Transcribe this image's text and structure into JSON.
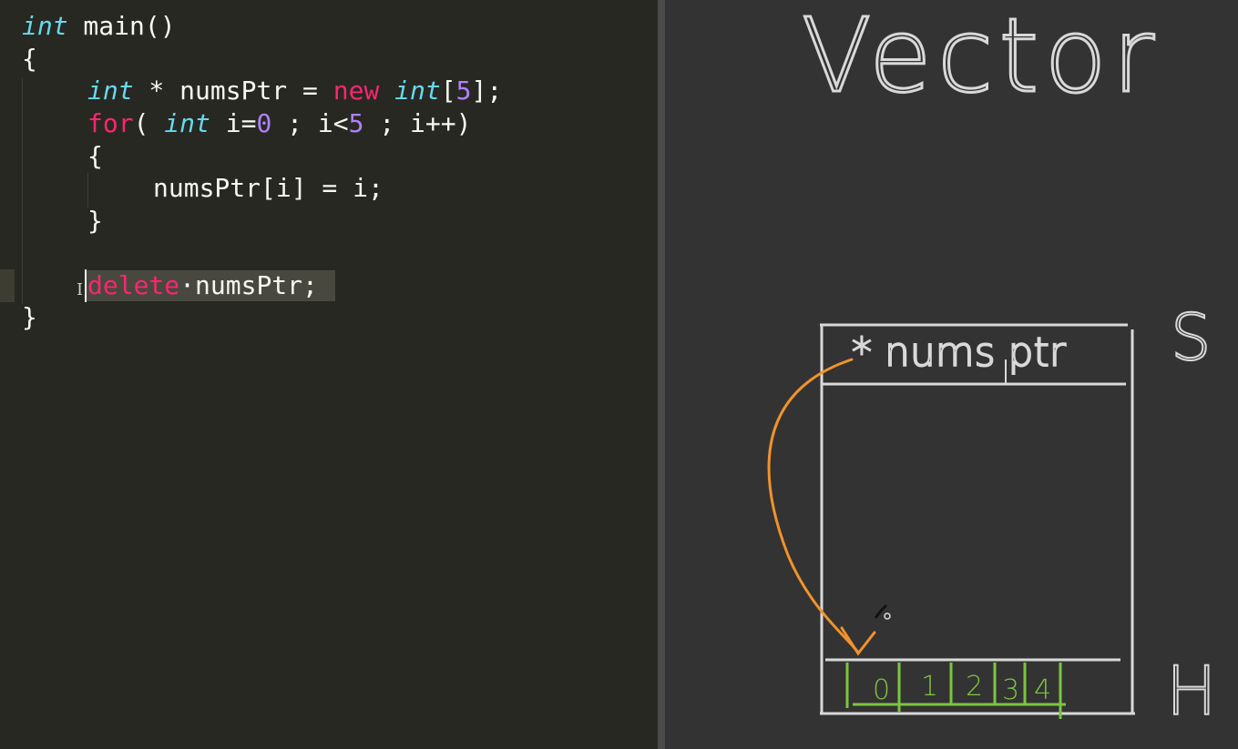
{
  "editor": {
    "lines": [
      {
        "parts": [
          {
            "t": "int",
            "c": "kw-type"
          },
          {
            "t": " main()",
            "c": "plain"
          }
        ]
      },
      {
        "parts": [
          {
            "t": "{",
            "c": "plain"
          }
        ]
      },
      {
        "parts": [
          {
            "t": "int",
            "c": "kw-type"
          },
          {
            "t": " * numsPtr = ",
            "c": "plain"
          },
          {
            "t": "new",
            "c": "kw"
          },
          {
            "t": " ",
            "c": "plain"
          },
          {
            "t": "int",
            "c": "kw-type"
          },
          {
            "t": "[",
            "c": "plain"
          },
          {
            "t": "5",
            "c": "num"
          },
          {
            "t": "];",
            "c": "plain"
          }
        ]
      },
      {
        "parts": [
          {
            "t": "for",
            "c": "kw"
          },
          {
            "t": "( ",
            "c": "plain"
          },
          {
            "t": "int",
            "c": "kw-type"
          },
          {
            "t": " i=",
            "c": "plain"
          },
          {
            "t": "0",
            "c": "num"
          },
          {
            "t": " ; i<",
            "c": "plain"
          },
          {
            "t": "5",
            "c": "num"
          },
          {
            "t": " ; i++)",
            "c": "plain"
          }
        ]
      },
      {
        "parts": [
          {
            "t": "{",
            "c": "plain"
          }
        ]
      },
      {
        "parts": [
          {
            "t": "numsPtr[i] = i;",
            "c": "plain"
          }
        ]
      },
      {
        "parts": [
          {
            "t": "}",
            "c": "plain"
          }
        ]
      },
      {
        "parts": []
      },
      {
        "parts": [
          {
            "t": "delete",
            "c": "kw"
          },
          {
            "t": "·",
            "c": "plain"
          },
          {
            "t": "numsPtr;",
            "c": "plain"
          }
        ]
      },
      {
        "parts": [
          {
            "t": "}",
            "c": "plain"
          }
        ]
      }
    ]
  },
  "board": {
    "title": "Vector",
    "stack_label": "S",
    "heap_label": "H",
    "stack_var": "* nums ptr",
    "array_cells": [
      "0",
      "1",
      "2",
      "3",
      "4"
    ],
    "colors": {
      "chalk": "#d9d9d9",
      "arrow": "#f0932b",
      "array": "#7cc540"
    }
  }
}
